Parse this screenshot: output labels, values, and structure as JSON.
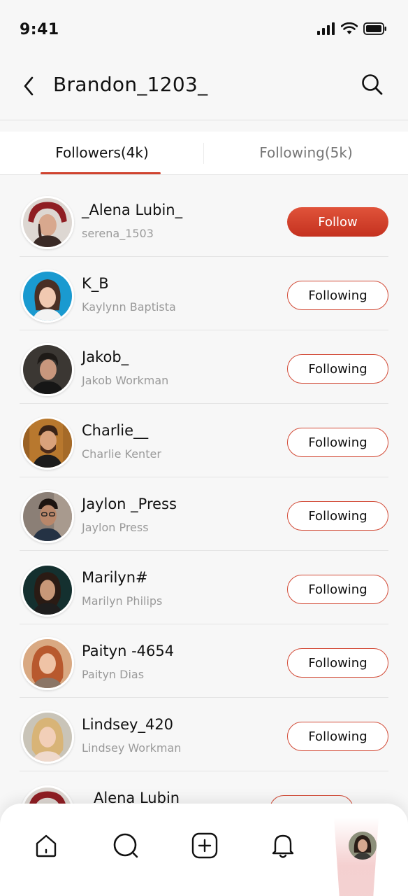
{
  "status_bar": {
    "time": "9:41"
  },
  "header": {
    "title": "Brandon_1203_"
  },
  "tabs": [
    {
      "label": "Followers(4k)"
    },
    {
      "label": "Following(5k)"
    }
  ],
  "users": [
    {
      "name": "_Alena Lubin_",
      "handle": "serena_1503",
      "button": "Follow"
    },
    {
      "name": "K_B",
      "handle": "Kaylynn Baptista",
      "button": "Following"
    },
    {
      "name": "Jakob_",
      "handle": "Jakob Workman",
      "button": "Following"
    },
    {
      "name": "Charlie__",
      "handle": "Charlie Kenter",
      "button": "Following"
    },
    {
      "name": "Jaylon _Press",
      "handle": "Jaylon Press",
      "button": "Following"
    },
    {
      "name": "Marilyn#",
      "handle": "Marilyn Philips",
      "button": "Following"
    },
    {
      "name": "Paityn -4654",
      "handle": "Paityn Dias",
      "button": "Following"
    },
    {
      "name": "Lindsey_420",
      "handle": "Lindsey Workman",
      "button": "Following"
    }
  ],
  "partial_user": {
    "name": "Alena Lubin"
  },
  "bottom_nav": {
    "items": [
      "home-icon",
      "search-icon",
      "add-post-icon",
      "notifications-icon",
      "profile-avatar"
    ]
  },
  "colors": {
    "accent": "#d0432f",
    "follow_button": "#cf3b27"
  }
}
